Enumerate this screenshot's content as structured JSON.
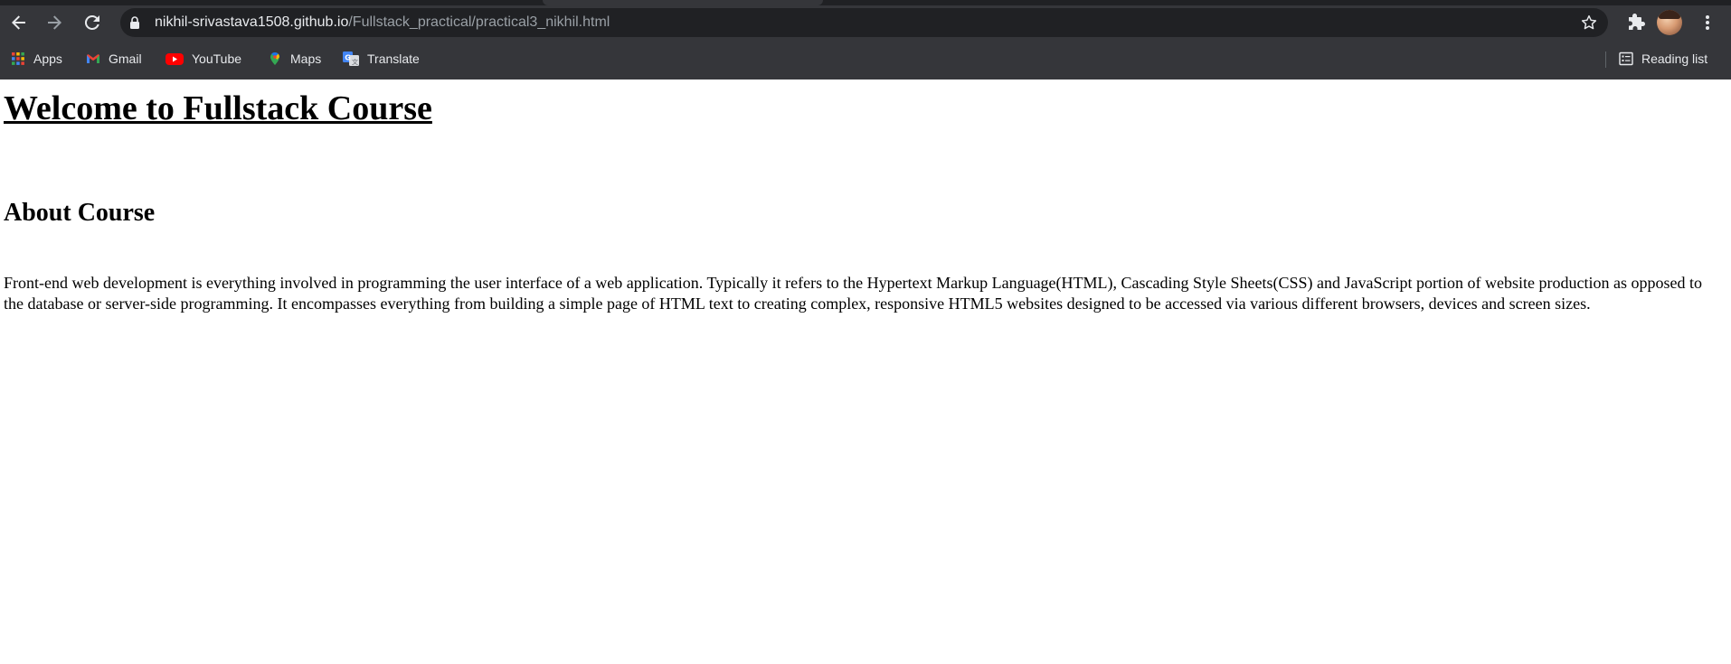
{
  "browser": {
    "url_host": "nikhil-srivastava1508.github.io",
    "url_path": "/Fullstack_practical/practical3_nikhil.html",
    "bookmarks": [
      {
        "label": "Apps",
        "icon": "apps-grid-icon"
      },
      {
        "label": "Gmail",
        "icon": "gmail-icon"
      },
      {
        "label": "YouTube",
        "icon": "youtube-icon"
      },
      {
        "label": "Maps",
        "icon": "maps-icon"
      },
      {
        "label": "Translate",
        "icon": "translate-icon"
      }
    ],
    "reading_list_label": "Reading list",
    "colors": {
      "toolbar_bg": "#35363a",
      "omnibox_bg": "#202124",
      "text": "#e8eaed",
      "url_path_text": "#9aa0a6"
    }
  },
  "page": {
    "heading": "Welcome to Fullstack Course",
    "subheading": "About Course",
    "paragraph": "Front-end web development is everything involved in programming the user interface of a web application. Typically it refers to the Hypertext Markup Language(HTML), Cascading Style Sheets(CSS) and JavaScript portion of website production as opposed to the database or server-side programming. It encompasses everything from building a simple page of HTML text to creating complex, responsive HTML5 websites designed to be accessed via various different browsers, devices and screen sizes."
  }
}
